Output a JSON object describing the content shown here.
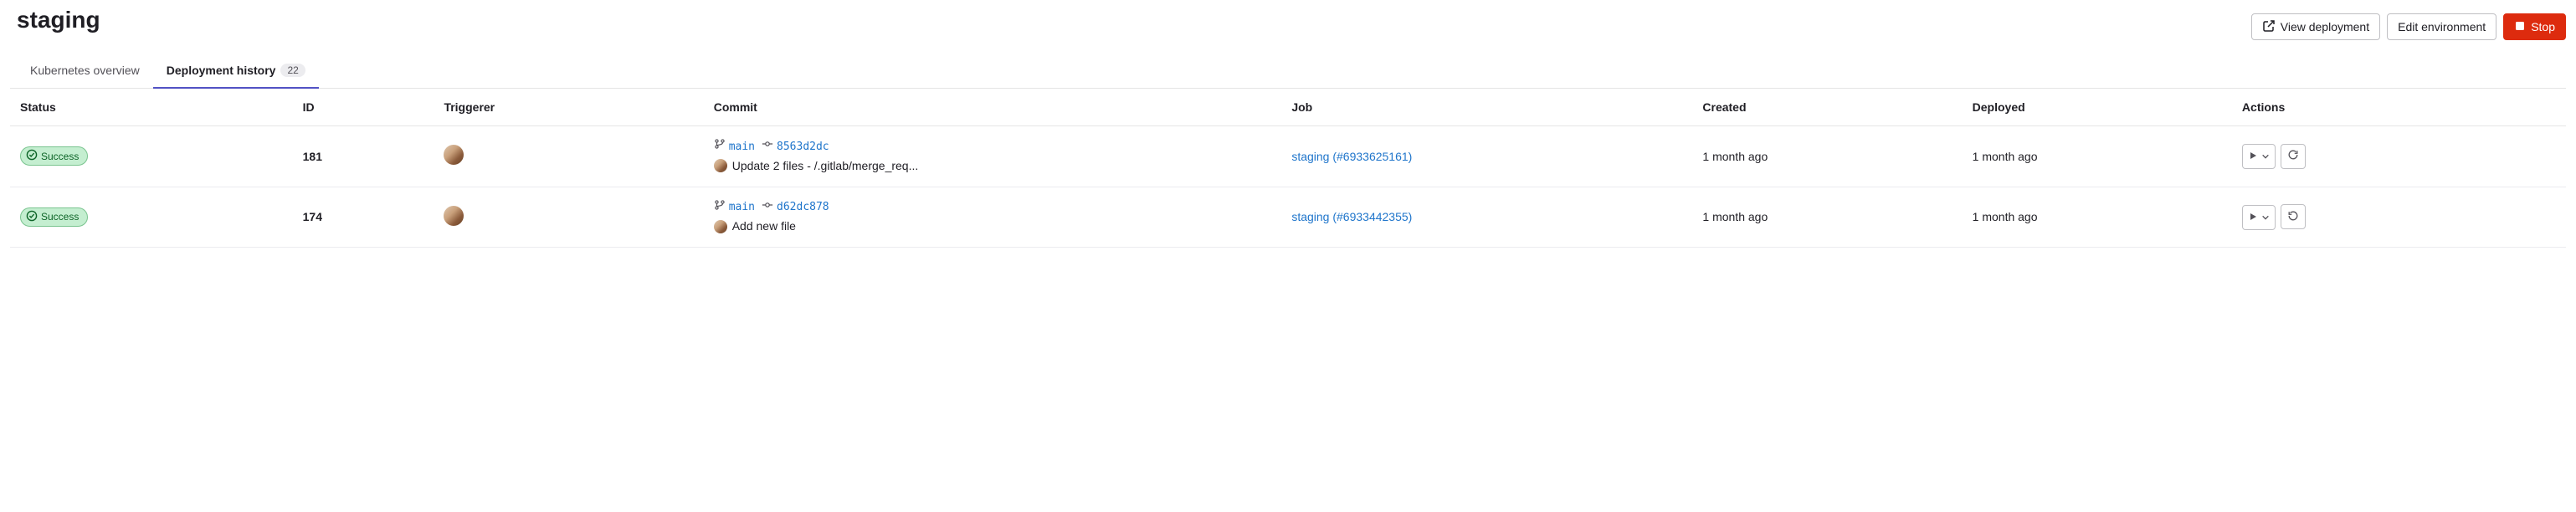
{
  "page": {
    "title": "staging",
    "buttons": {
      "view_deployment": "View deployment",
      "edit_environment": "Edit environment",
      "stop": "Stop"
    }
  },
  "tabs": [
    {
      "key": "k8s",
      "label": "Kubernetes overview",
      "active": false,
      "count": null
    },
    {
      "key": "history",
      "label": "Deployment history",
      "active": true,
      "count": "22"
    }
  ],
  "columns": {
    "status": "Status",
    "id": "ID",
    "triggerer": "Triggerer",
    "commit": "Commit",
    "job": "Job",
    "created": "Created",
    "deployed": "Deployed",
    "actions": "Actions"
  },
  "rows": [
    {
      "status": "Success",
      "id": "181",
      "branch": "main",
      "sha": "8563d2dc",
      "message": "Update 2 files - /.gitlab/merge_req...",
      "job": "staging (#6933625161)",
      "created": "1 month ago",
      "deployed": "1 month ago",
      "retry_icon": "redo"
    },
    {
      "status": "Success",
      "id": "174",
      "branch": "main",
      "sha": "d62dc878",
      "message": "Add new file",
      "job": "staging (#6933442355)",
      "created": "1 month ago",
      "deployed": "1 month ago",
      "retry_icon": "history"
    }
  ]
}
